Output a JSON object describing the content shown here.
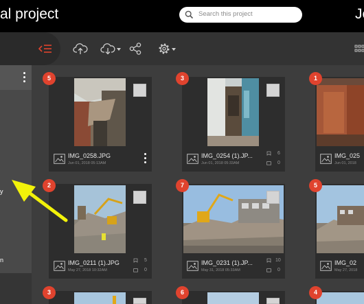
{
  "header": {
    "title": "al project",
    "search_placeholder": "Search this project",
    "user_initials": "Je"
  },
  "toolbar": {
    "icons": [
      "collapse-menu-icon",
      "upload-icon",
      "download-icon",
      "share-icon",
      "settings-icon",
      "grid-view-icon"
    ]
  },
  "sidebar": {
    "items": [
      "y",
      "n"
    ]
  },
  "photos": [
    {
      "badge": "5",
      "name": "IMG_0258.JPG",
      "date": "Jun 01, 2018 05:13AM",
      "counts": []
    },
    {
      "badge": "3",
      "name": "IMG_0254 (1).JP...",
      "date": "Jun 01, 2018 05:33AM",
      "counts": [
        "6",
        "0"
      ]
    },
    {
      "badge": "1",
      "name": "IMG_025",
      "date": "Jun 01, 2018",
      "counts": []
    },
    {
      "badge": "2",
      "name": "IMG_0211 (1).JPG",
      "date": "May 27, 2018 10:32AM",
      "counts": [
        "5",
        "0"
      ]
    },
    {
      "badge": "7",
      "name": "IMG_0231 (1).JP...",
      "date": "May 31, 2018 05:33AM",
      "counts": [
        "10",
        "0"
      ]
    },
    {
      "badge": "5",
      "name": "IMG_02",
      "date": "May 27, 2018",
      "counts": []
    },
    {
      "badge": "3",
      "name": "",
      "date": "",
      "counts": []
    },
    {
      "badge": "6",
      "name": "",
      "date": "",
      "counts": []
    },
    {
      "badge": "4",
      "name": "",
      "date": "",
      "counts": []
    }
  ],
  "colors": {
    "accent": "#e0432e",
    "header_bg": "#000000",
    "toolbar_bg": "#333333",
    "grid_bg": "#3d3d3d",
    "card_bg": "#2d2d2d",
    "annotation_arrow": "#f2f20a"
  }
}
